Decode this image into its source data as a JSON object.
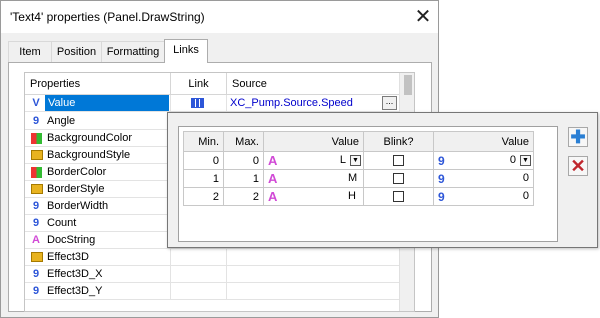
{
  "window": {
    "title": "'Text4' properties (Panel.DrawString)",
    "close_glyph": "✕"
  },
  "tabs": [
    {
      "label": "Item"
    },
    {
      "label": "Position"
    },
    {
      "label": "Formatting"
    },
    {
      "label": "Links",
      "active": true
    }
  ],
  "grid": {
    "headers": {
      "properties": "Properties",
      "link": "Link",
      "source": "Source"
    },
    "rows": [
      {
        "name": "Value",
        "icon": "value-v-icon",
        "selected": true,
        "source": "XC_Pump.Source.Speed"
      },
      {
        "name": "Angle",
        "icon": "number-icon"
      },
      {
        "name": "BackgroundColor",
        "icon": "color-icon"
      },
      {
        "name": "BackgroundStyle",
        "icon": "style-icon"
      },
      {
        "name": "BorderColor",
        "icon": "color-icon"
      },
      {
        "name": "BorderStyle",
        "icon": "style-icon"
      },
      {
        "name": "BorderWidth",
        "icon": "number-icon"
      },
      {
        "name": "Count",
        "icon": "number-icon"
      },
      {
        "name": "DocString",
        "icon": "text-icon"
      },
      {
        "name": "Effect3D",
        "icon": "style-icon"
      },
      {
        "name": "Effect3D_X",
        "icon": "number-icon"
      },
      {
        "name": "Effect3D_Y",
        "icon": "number-icon"
      }
    ],
    "ellipsis": "..."
  },
  "links_popup": {
    "headers": {
      "min": "Min.",
      "max": "Max.",
      "value": "Value",
      "blink": "Blink?",
      "value2": "Value"
    },
    "rows": [
      {
        "min": "0",
        "max": "0",
        "text_value": "L",
        "value": "0"
      },
      {
        "min": "1",
        "max": "1",
        "text_value": "M",
        "value": "0"
      },
      {
        "min": "2",
        "max": "2",
        "text_value": "H",
        "value": "0"
      }
    ],
    "add_glyph": "✚",
    "delete_glyph": "✕"
  },
  "colors": {
    "selection": "#0078d7",
    "source_text": "#0000cc",
    "add": "#2a7fd4",
    "delete": "#c0262d"
  }
}
